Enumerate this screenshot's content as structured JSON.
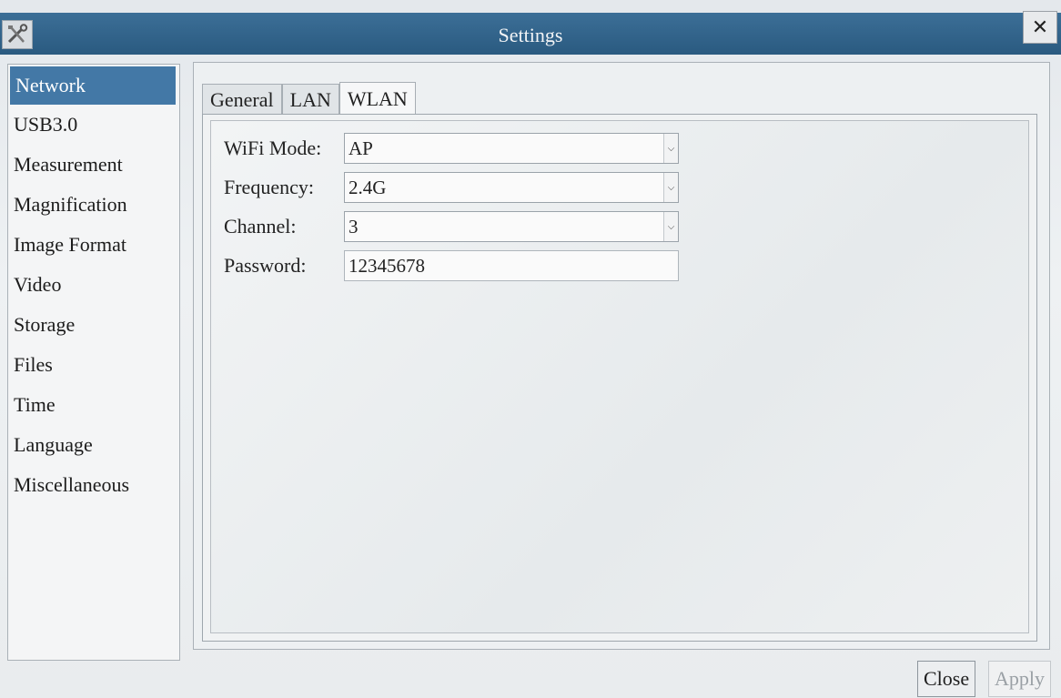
{
  "window": {
    "title": "Settings",
    "app_icon": "tools-icon",
    "close_glyph": "✕"
  },
  "sidebar": {
    "items": [
      {
        "label": "Network",
        "selected": true
      },
      {
        "label": "USB3.0"
      },
      {
        "label": "Measurement"
      },
      {
        "label": "Magnification"
      },
      {
        "label": "Image Format"
      },
      {
        "label": "Video"
      },
      {
        "label": "Storage"
      },
      {
        "label": "Files"
      },
      {
        "label": "Time"
      },
      {
        "label": "Language"
      },
      {
        "label": "Miscellaneous"
      }
    ]
  },
  "tabs": [
    {
      "label": "General"
    },
    {
      "label": "LAN"
    },
    {
      "label": "WLAN",
      "active": true
    }
  ],
  "form": {
    "wifi_mode": {
      "label": "WiFi Mode:",
      "value": "AP"
    },
    "frequency": {
      "label": "Frequency:",
      "value": "2.4G"
    },
    "channel": {
      "label": "Channel:",
      "value": "3"
    },
    "password": {
      "label": "Password:",
      "value": "12345678"
    }
  },
  "buttons": {
    "close": "Close",
    "apply": "Apply"
  },
  "colors": {
    "titlebar": "#2f628a",
    "selection": "#4378a6"
  }
}
